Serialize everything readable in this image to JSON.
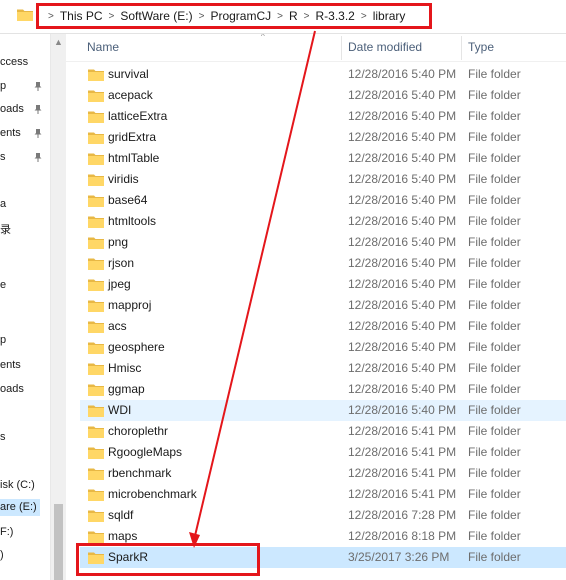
{
  "breadcrumb": [
    "This PC",
    "SoftWare (E:)",
    "ProgramCJ",
    "R",
    "R-3.3.2",
    "library"
  ],
  "columns": {
    "name": "Name",
    "date": "Date modified",
    "type": "Type"
  },
  "nav": {
    "items": [
      "ccess",
      "p",
      "oads",
      "ents",
      "s",
      "a",
      "录",
      "",
      "e",
      "p",
      "ents",
      "oads",
      "s",
      "isk (C:)",
      "are (E:)",
      "F:)",
      ")"
    ]
  },
  "files": [
    {
      "name": "survival",
      "date": "12/28/2016 5:40 PM",
      "type": "File folder"
    },
    {
      "name": "acepack",
      "date": "12/28/2016 5:40 PM",
      "type": "File folder"
    },
    {
      "name": "latticeExtra",
      "date": "12/28/2016 5:40 PM",
      "type": "File folder"
    },
    {
      "name": "gridExtra",
      "date": "12/28/2016 5:40 PM",
      "type": "File folder"
    },
    {
      "name": "htmlTable",
      "date": "12/28/2016 5:40 PM",
      "type": "File folder"
    },
    {
      "name": "viridis",
      "date": "12/28/2016 5:40 PM",
      "type": "File folder"
    },
    {
      "name": "base64",
      "date": "12/28/2016 5:40 PM",
      "type": "File folder"
    },
    {
      "name": "htmltools",
      "date": "12/28/2016 5:40 PM",
      "type": "File folder"
    },
    {
      "name": "png",
      "date": "12/28/2016 5:40 PM",
      "type": "File folder"
    },
    {
      "name": "rjson",
      "date": "12/28/2016 5:40 PM",
      "type": "File folder"
    },
    {
      "name": "jpeg",
      "date": "12/28/2016 5:40 PM",
      "type": "File folder"
    },
    {
      "name": "mapproj",
      "date": "12/28/2016 5:40 PM",
      "type": "File folder"
    },
    {
      "name": "acs",
      "date": "12/28/2016 5:40 PM",
      "type": "File folder"
    },
    {
      "name": "geosphere",
      "date": "12/28/2016 5:40 PM",
      "type": "File folder"
    },
    {
      "name": "Hmisc",
      "date": "12/28/2016 5:40 PM",
      "type": "File folder"
    },
    {
      "name": "ggmap",
      "date": "12/28/2016 5:40 PM",
      "type": "File folder"
    },
    {
      "name": "WDI",
      "date": "12/28/2016 5:40 PM",
      "type": "File folder"
    },
    {
      "name": "choroplethr",
      "date": "12/28/2016 5:41 PM",
      "type": "File folder"
    },
    {
      "name": "RgoogleMaps",
      "date": "12/28/2016 5:41 PM",
      "type": "File folder"
    },
    {
      "name": "rbenchmark",
      "date": "12/28/2016 5:41 PM",
      "type": "File folder"
    },
    {
      "name": "microbenchmark",
      "date": "12/28/2016 5:41 PM",
      "type": "File folder"
    },
    {
      "name": "sqldf",
      "date": "12/28/2016 7:28 PM",
      "type": "File folder"
    },
    {
      "name": "maps",
      "date": "12/28/2016 8:18 PM",
      "type": "File folder"
    },
    {
      "name": "SparkR",
      "date": "3/25/2017 3:26 PM",
      "type": "File folder"
    }
  ],
  "highlighted_row": "WDI",
  "selected_row": "SparkR",
  "colors": {
    "annotation": "#e4161b",
    "selection": "#cce8ff",
    "hover": "#e5f3ff",
    "folder": "#ffd766"
  }
}
